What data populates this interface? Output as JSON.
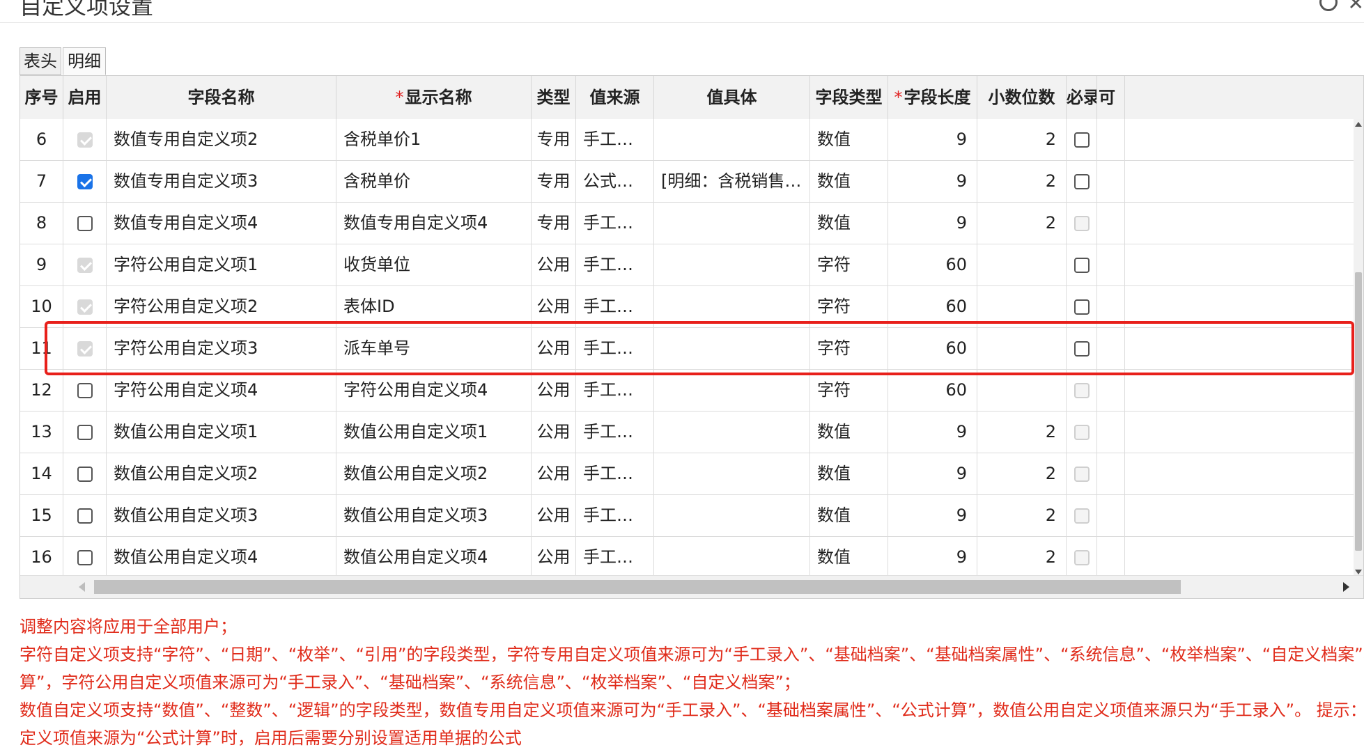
{
  "window": {
    "title": "自定义项设置"
  },
  "tabs": [
    {
      "label": "表头",
      "active": false
    },
    {
      "label": "明细",
      "active": true
    }
  ],
  "table": {
    "headers": {
      "index": "序号",
      "enabled": "启用",
      "field_name": "字段名称",
      "display_name": "显示名称",
      "type": "类型",
      "value_source": "值来源",
      "value_detail": "值具体",
      "field_type": "字段类型",
      "field_length": "字段长度",
      "decimals": "小数位数",
      "required": "必录",
      "extra": "可"
    },
    "rows": [
      {
        "index": "6",
        "enabled": "checked-disabled",
        "field_name": "数值专用自定义项2",
        "display_name": "含税单价1",
        "type": "专用",
        "value_source": "手工录入",
        "value_detail": "",
        "field_type": "数值",
        "field_length": "9",
        "decimals": "2",
        "required": "unchecked"
      },
      {
        "index": "7",
        "enabled": "checked",
        "field_name": "数值专用自定义项3",
        "display_name": "含税单价",
        "type": "专用",
        "value_source": "公式计算",
        "value_detail": "[明细：含税销售金…",
        "field_type": "数值",
        "field_length": "9",
        "decimals": "2",
        "required": "unchecked"
      },
      {
        "index": "8",
        "enabled": "unchecked",
        "field_name": "数值专用自定义项4",
        "display_name": "数值专用自定义项4",
        "type": "专用",
        "value_source": "手工录入",
        "value_detail": "",
        "field_type": "数值",
        "field_length": "9",
        "decimals": "2",
        "required": "disabled"
      },
      {
        "index": "9",
        "enabled": "checked-disabled",
        "field_name": "字符公用自定义项1",
        "display_name": "收货单位",
        "type": "公用",
        "value_source": "手工录入",
        "value_detail": "",
        "field_type": "字符",
        "field_length": "60",
        "decimals": "",
        "required": "unchecked"
      },
      {
        "index": "10",
        "enabled": "checked-disabled",
        "field_name": "字符公用自定义项2",
        "display_name": "表体ID",
        "type": "公用",
        "value_source": "手工录入",
        "value_detail": "",
        "field_type": "字符",
        "field_length": "60",
        "decimals": "",
        "required": "unchecked"
      },
      {
        "index": "11",
        "enabled": "checked-disabled",
        "field_name": "字符公用自定义项3",
        "display_name": "派车单号",
        "type": "公用",
        "value_source": "手工录入",
        "value_detail": "",
        "field_type": "字符",
        "field_length": "60",
        "decimals": "",
        "required": "unchecked"
      },
      {
        "index": "12",
        "enabled": "unchecked",
        "field_name": "字符公用自定义项4",
        "display_name": "字符公用自定义项4",
        "type": "公用",
        "value_source": "手工录入",
        "value_detail": "",
        "field_type": "字符",
        "field_length": "60",
        "decimals": "",
        "required": "disabled"
      },
      {
        "index": "13",
        "enabled": "unchecked",
        "field_name": "数值公用自定义项1",
        "display_name": "数值公用自定义项1",
        "type": "公用",
        "value_source": "手工录入",
        "value_detail": "",
        "field_type": "数值",
        "field_length": "9",
        "decimals": "2",
        "required": "disabled"
      },
      {
        "index": "14",
        "enabled": "unchecked",
        "field_name": "数值公用自定义项2",
        "display_name": "数值公用自定义项2",
        "type": "公用",
        "value_source": "手工录入",
        "value_detail": "",
        "field_type": "数值",
        "field_length": "9",
        "decimals": "2",
        "required": "disabled"
      },
      {
        "index": "15",
        "enabled": "unchecked",
        "field_name": "数值公用自定义项3",
        "display_name": "数值公用自定义项3",
        "type": "公用",
        "value_source": "手工录入",
        "value_detail": "",
        "field_type": "数值",
        "field_length": "9",
        "decimals": "2",
        "required": "disabled"
      },
      {
        "index": "16",
        "enabled": "unchecked",
        "field_name": "数值公用自定义项4",
        "display_name": "数值公用自定义项4",
        "type": "公用",
        "value_source": "手工录入",
        "value_detail": "",
        "field_type": "数值",
        "field_length": "9",
        "decimals": "2",
        "required": "disabled"
      }
    ]
  },
  "notes": [
    "调整内容将应用于全部用户；",
    "字符自定义项支持“字符”、“日期”、“枚举”、“引用”的字段类型，字符专用自定义项值来源可为“手工录入”、“基础档案”、“基础档案属性”、“系统信息”、“枚举档案”、“自定义档案”、“公式计",
    "算”，字符公用自定义项值来源可为“手工录入”、“基础档案”、“系统信息”、“枚举档案”、“自定义档案”；",
    "数值自定义项支持“数值”、“整数”、“逻辑”的字段类型，数值专用自定义项值来源可为“手工录入”、“基础档案属性”、“公式计算”，数值公用自定义项值来源只为“手工录入”。 提示：公有自",
    "定义项值来源为“公式计算”时，启用后需要分别设置适用单据的公式"
  ],
  "colors": {
    "accent": "#1a73e8",
    "highlight": "#e8201b",
    "note": "#e02b1a"
  }
}
